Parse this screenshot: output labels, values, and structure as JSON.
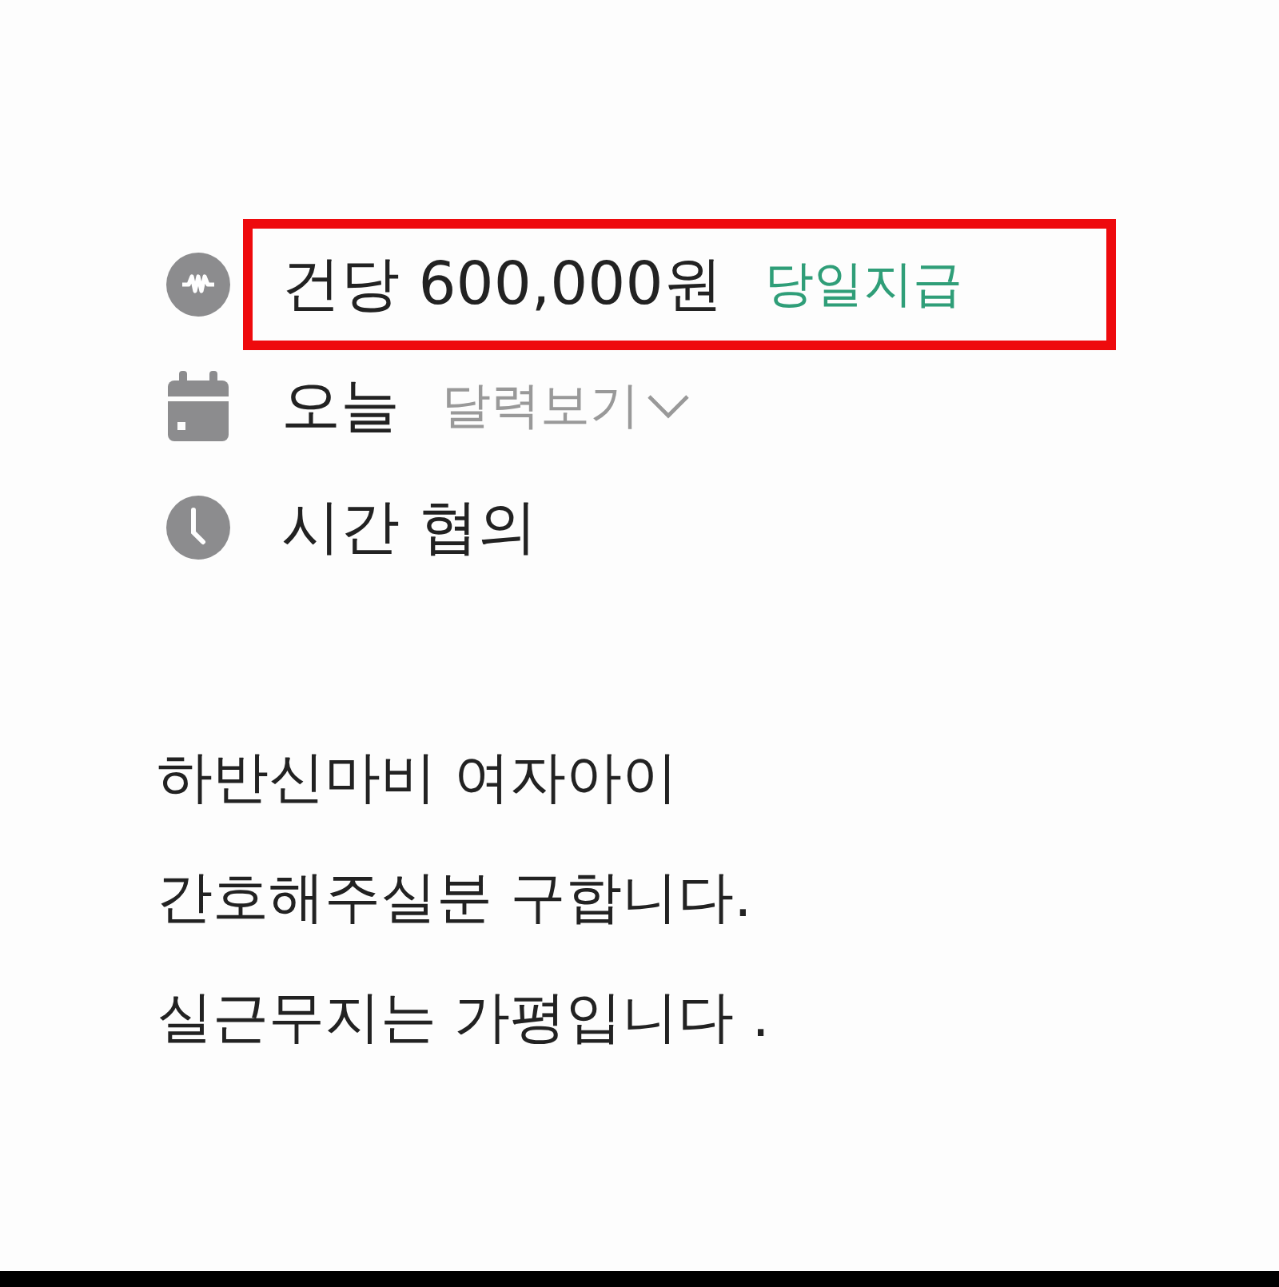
{
  "details": [
    {
      "kind": "pay",
      "text": "건당 600,000원",
      "note": "당일지급",
      "highlighted": true
    },
    {
      "kind": "date",
      "text": "오늘",
      "link": "달력보기"
    },
    {
      "kind": "time",
      "text": "시간 협의"
    }
  ],
  "description": [
    "하반신마비 여자아이",
    "간호해주실분 구합니다.",
    "실근무지는 가평입니다 ."
  ]
}
